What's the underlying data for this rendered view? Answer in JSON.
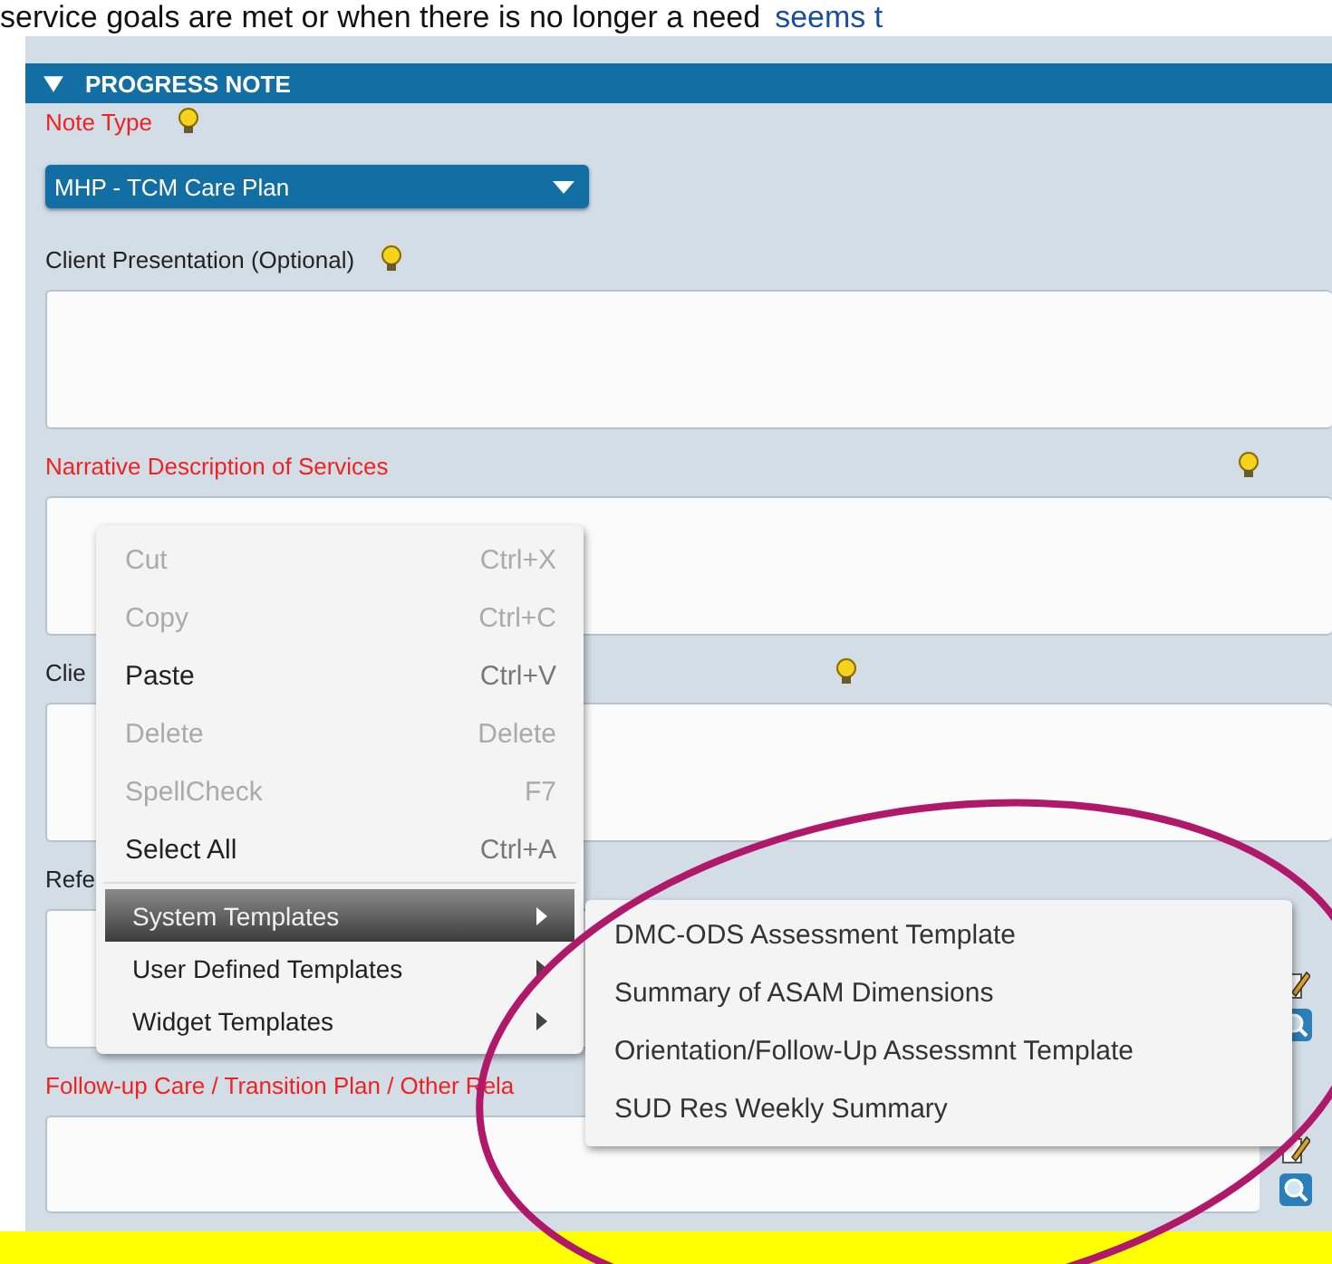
{
  "document_text": {
    "text": "service goals are met or when there is no longer a need",
    "link": "seems t"
  },
  "section": {
    "title": "PROGRESS NOTE",
    "expanded": true
  },
  "note_type": {
    "label": "Note Type",
    "required": true,
    "value": "MHP - TCM Care Plan"
  },
  "fields": [
    {
      "kind": "inline",
      "label": "Client Presentation (Optional)",
      "required": false,
      "tools": false
    },
    {
      "kind": "right",
      "label": "Narrative Description of Services",
      "required": true,
      "tools": false
    },
    {
      "kind": "middle",
      "label": "Clie",
      "required": false,
      "tools": false
    },
    {
      "kind": "plain",
      "label": "Refe",
      "required": false,
      "tools": true
    },
    {
      "kind": "plain",
      "label": "Follow-up Care / Transition Plan / Other Rela",
      "required": true,
      "tools": true
    }
  ],
  "context_menu": {
    "items": [
      {
        "kind": "command",
        "label": "Cut",
        "shortcut": "Ctrl+X",
        "disabled": true
      },
      {
        "kind": "command",
        "label": "Copy",
        "shortcut": "Ctrl+C",
        "disabled": true
      },
      {
        "kind": "command",
        "label": "Paste",
        "shortcut": "Ctrl+V",
        "disabled": false
      },
      {
        "kind": "command",
        "label": "Delete",
        "shortcut": "Delete",
        "disabled": true
      },
      {
        "kind": "command",
        "label": "SpellCheck",
        "shortcut": "F7",
        "disabled": true
      },
      {
        "kind": "command",
        "label": "Select All",
        "shortcut": "Ctrl+A",
        "disabled": false
      },
      {
        "kind": "submenu",
        "label": "System Templates",
        "selected": true
      },
      {
        "kind": "submenu",
        "label": "User Defined Templates",
        "selected": false
      },
      {
        "kind": "submenu",
        "label": "Widget Templates",
        "selected": false
      }
    ]
  },
  "submenu": {
    "items": [
      "DMC-ODS Assessment Template",
      "Summary of ASAM Dimensions",
      "Orientation/Follow-Up Assessmnt Template",
      "SUD Res Weekly Summary"
    ]
  },
  "annotation": {
    "kind": "ellipse",
    "color": "#b0186a"
  }
}
